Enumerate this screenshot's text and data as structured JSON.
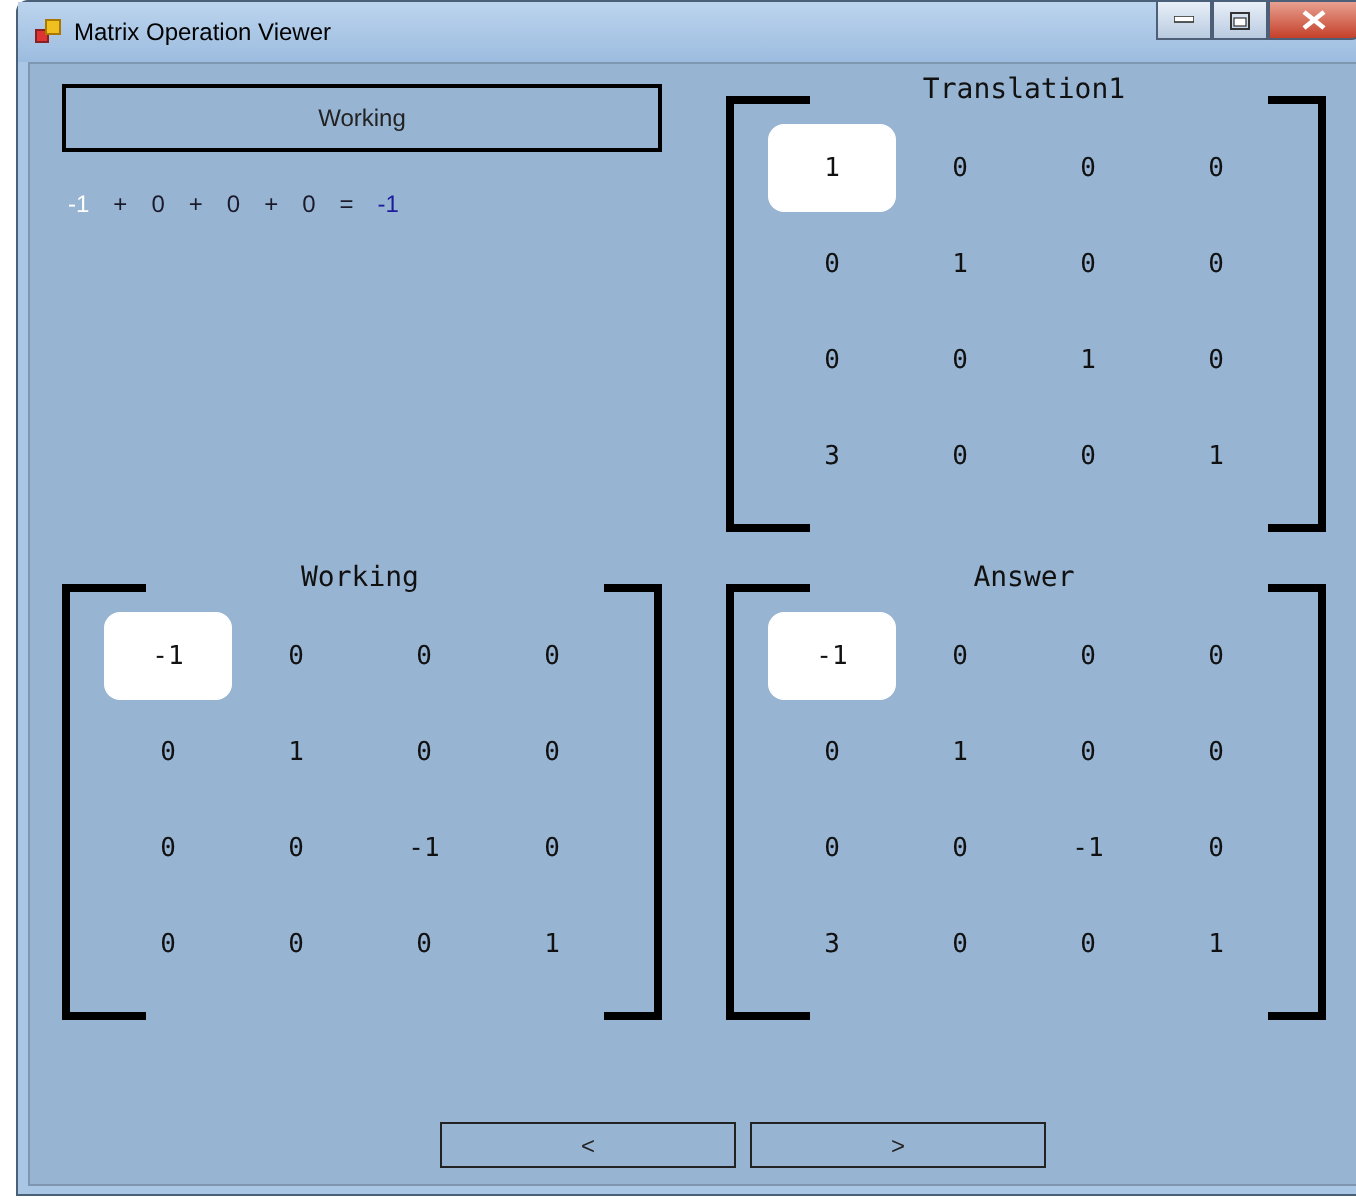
{
  "window": {
    "title": "Matrix Operation Viewer"
  },
  "status": "Working",
  "equation": [
    {
      "text": "-1",
      "kind": "highlight"
    },
    {
      "text": "+",
      "kind": "normal"
    },
    {
      "text": "0",
      "kind": "normal"
    },
    {
      "text": "+",
      "kind": "normal"
    },
    {
      "text": "0",
      "kind": "normal"
    },
    {
      "text": "+",
      "kind": "normal"
    },
    {
      "text": "0",
      "kind": "normal"
    },
    {
      "text": "=",
      "kind": "normal"
    },
    {
      "text": "-1",
      "kind": "result"
    }
  ],
  "matrices": [
    {
      "title": "Translation1",
      "rows": [
        [
          {
            "value": "1",
            "selected": true
          },
          {
            "value": "0",
            "selected": false
          },
          {
            "value": "0",
            "selected": false
          },
          {
            "value": "0",
            "selected": false
          }
        ],
        [
          {
            "value": "0",
            "selected": false
          },
          {
            "value": "1",
            "selected": false
          },
          {
            "value": "0",
            "selected": false
          },
          {
            "value": "0",
            "selected": false
          }
        ],
        [
          {
            "value": "0",
            "selected": false
          },
          {
            "value": "0",
            "selected": false
          },
          {
            "value": "1",
            "selected": false
          },
          {
            "value": "0",
            "selected": false
          }
        ],
        [
          {
            "value": "3",
            "selected": false
          },
          {
            "value": "0",
            "selected": false
          },
          {
            "value": "0",
            "selected": false
          },
          {
            "value": "1",
            "selected": false
          }
        ]
      ]
    },
    {
      "title": "Working",
      "rows": [
        [
          {
            "value": "-1",
            "selected": true
          },
          {
            "value": "0",
            "selected": false
          },
          {
            "value": "0",
            "selected": false
          },
          {
            "value": "0",
            "selected": false
          }
        ],
        [
          {
            "value": "0",
            "selected": false
          },
          {
            "value": "1",
            "selected": false
          },
          {
            "value": "0",
            "selected": false
          },
          {
            "value": "0",
            "selected": false
          }
        ],
        [
          {
            "value": "0",
            "selected": false
          },
          {
            "value": "0",
            "selected": false
          },
          {
            "value": "-1",
            "selected": false
          },
          {
            "value": "0",
            "selected": false
          }
        ],
        [
          {
            "value": "0",
            "selected": false
          },
          {
            "value": "0",
            "selected": false
          },
          {
            "value": "0",
            "selected": false
          },
          {
            "value": "1",
            "selected": false
          }
        ]
      ]
    },
    {
      "title": "Answer",
      "rows": [
        [
          {
            "value": "-1",
            "selected": true
          },
          {
            "value": "0",
            "selected": false
          },
          {
            "value": "0",
            "selected": false
          },
          {
            "value": "0",
            "selected": false
          }
        ],
        [
          {
            "value": "0",
            "selected": false
          },
          {
            "value": "1",
            "selected": false
          },
          {
            "value": "0",
            "selected": false
          },
          {
            "value": "0",
            "selected": false
          }
        ],
        [
          {
            "value": "0",
            "selected": false
          },
          {
            "value": "0",
            "selected": false
          },
          {
            "value": "-1",
            "selected": false
          },
          {
            "value": "0",
            "selected": false
          }
        ],
        [
          {
            "value": "3",
            "selected": false
          },
          {
            "value": "0",
            "selected": false
          },
          {
            "value": "0",
            "selected": false
          },
          {
            "value": "1",
            "selected": false
          }
        ]
      ]
    }
  ],
  "nav_buttons": [
    "<",
    ">"
  ]
}
